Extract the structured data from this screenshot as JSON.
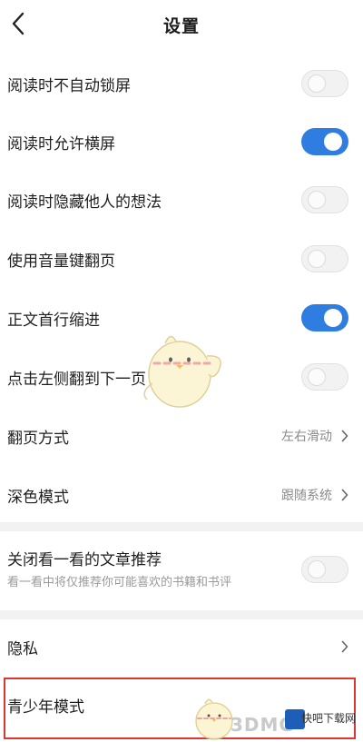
{
  "header": {
    "title": "设置"
  },
  "settings": [
    {
      "label": "阅读时不自动锁屏",
      "state": "off"
    },
    {
      "label": "阅读时允许横屏",
      "state": "on"
    },
    {
      "label": "阅读时隐藏他人的想法",
      "state": "off"
    },
    {
      "label": "使用音量键翻页",
      "state": "off"
    },
    {
      "label": "正文首行缩进",
      "state": "on"
    },
    {
      "label": "点击左侧翻到下一页",
      "state": "off"
    }
  ],
  "page_turn": {
    "label": "翻页方式",
    "value": "左右滑动"
  },
  "dark_mode": {
    "label": "深色模式",
    "value": "跟随系统"
  },
  "recommend": {
    "label": "关闭看一看的文章推荐",
    "sub": "看一看中将仅推荐你可能喜欢的书籍和书评",
    "state": "off"
  },
  "privacy": {
    "label": "隐私"
  },
  "youth_mode": {
    "label": "青少年模式"
  },
  "watermark": {
    "site": "3DMG",
    "brand": "快吧下载网"
  },
  "colors": {
    "accent": "#2f7de1",
    "highlight": "#d9372f"
  }
}
